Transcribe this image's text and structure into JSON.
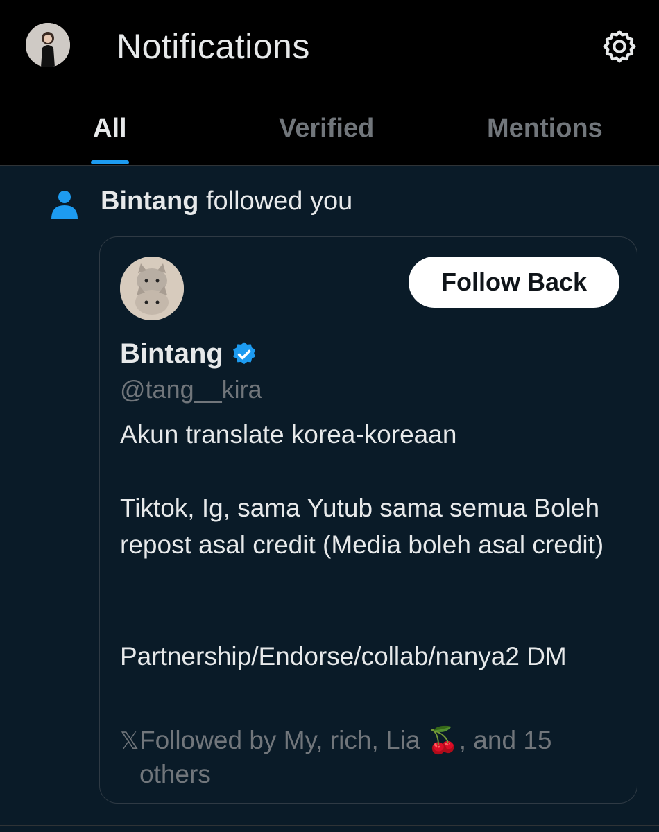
{
  "header": {
    "title": "Notifications",
    "settings_icon": "gear-icon",
    "avatar_icon": "profile-avatar"
  },
  "tabs": [
    {
      "label": "All",
      "active": true
    },
    {
      "label": "Verified",
      "active": false
    },
    {
      "label": "Mentions",
      "active": false
    }
  ],
  "notification": {
    "icon": "person-icon",
    "actor": "Bintang",
    "action": "followed you",
    "card": {
      "name": "Bintang",
      "handle": "@tang__kira",
      "verified_icon": "verified-badge-icon",
      "follow_back_label": "Follow Back",
      "bio_line1": "Akun translate korea-koreaan",
      "bio_line2": "Tiktok, Ig, sama Yutub sama semua Boleh repost asal credit (Media boleh asal credit)",
      "bio_line3": "Partnership/Endorse/collab/nanya2 DM",
      "followed_by": "Followed by My, rich, Lia 🍒, and 15 others"
    }
  },
  "colors": {
    "background": "#0a1b28",
    "topbar": "#000000",
    "accent": "#1d9bf0",
    "muted_text": "#71767b",
    "primary_text": "#e7e9ea"
  }
}
